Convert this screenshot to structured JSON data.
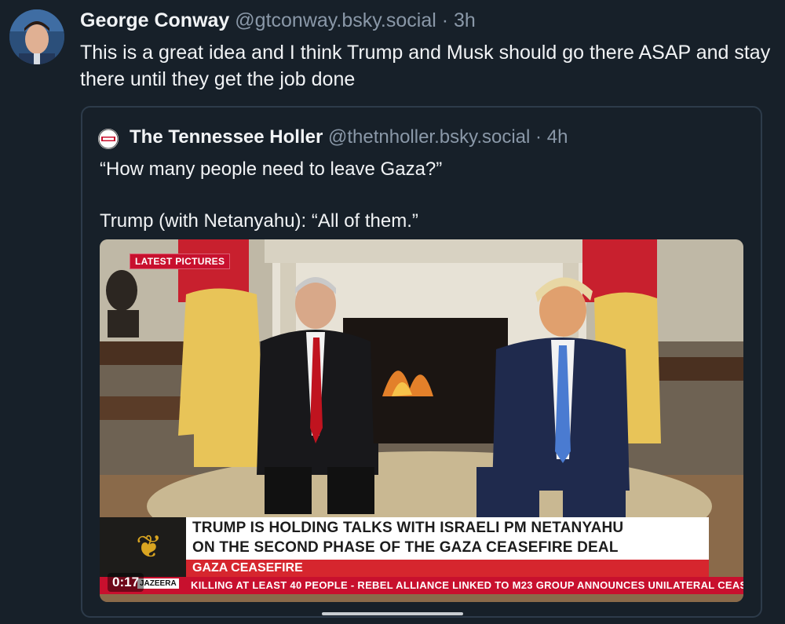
{
  "post": {
    "author_name": "George Conway",
    "handle": "@gtconway.bsky.social",
    "separator": "·",
    "time": "3h",
    "text": "This is a great idea and I think Trump and Musk should go there ASAP and stay there until they get the job done"
  },
  "quote": {
    "author_name": "The Tennessee Holler",
    "handle": "@thetnholler.bsky.social",
    "separator": "·",
    "time": "4h",
    "line1": "“How many people need to leave Gaza?”",
    "line2": "Trump (with Netanyahu): “All of them.”"
  },
  "video": {
    "badge": "LATEST PICTURES",
    "headline_line1": "TRUMP IS HOLDING TALKS WITH ISRAELI PM NETANYAHU",
    "headline_line2": "ON THE SECOND PHASE OF THE GAZA CEASEFIRE DEAL",
    "topic": "GAZA CEASEFIRE",
    "ticker": "KILLING AT LEAST 40 PEOPLE  -  REBEL ALLIANCE LINKED TO M23 GROUP ANNOUNCES UNILATERAL CEAS",
    "network": "JAZEERA",
    "timestamp": "0:17"
  },
  "colors": {
    "background": "#172029",
    "handle": "#8a98a8",
    "breaking_red": "#c8102e"
  }
}
